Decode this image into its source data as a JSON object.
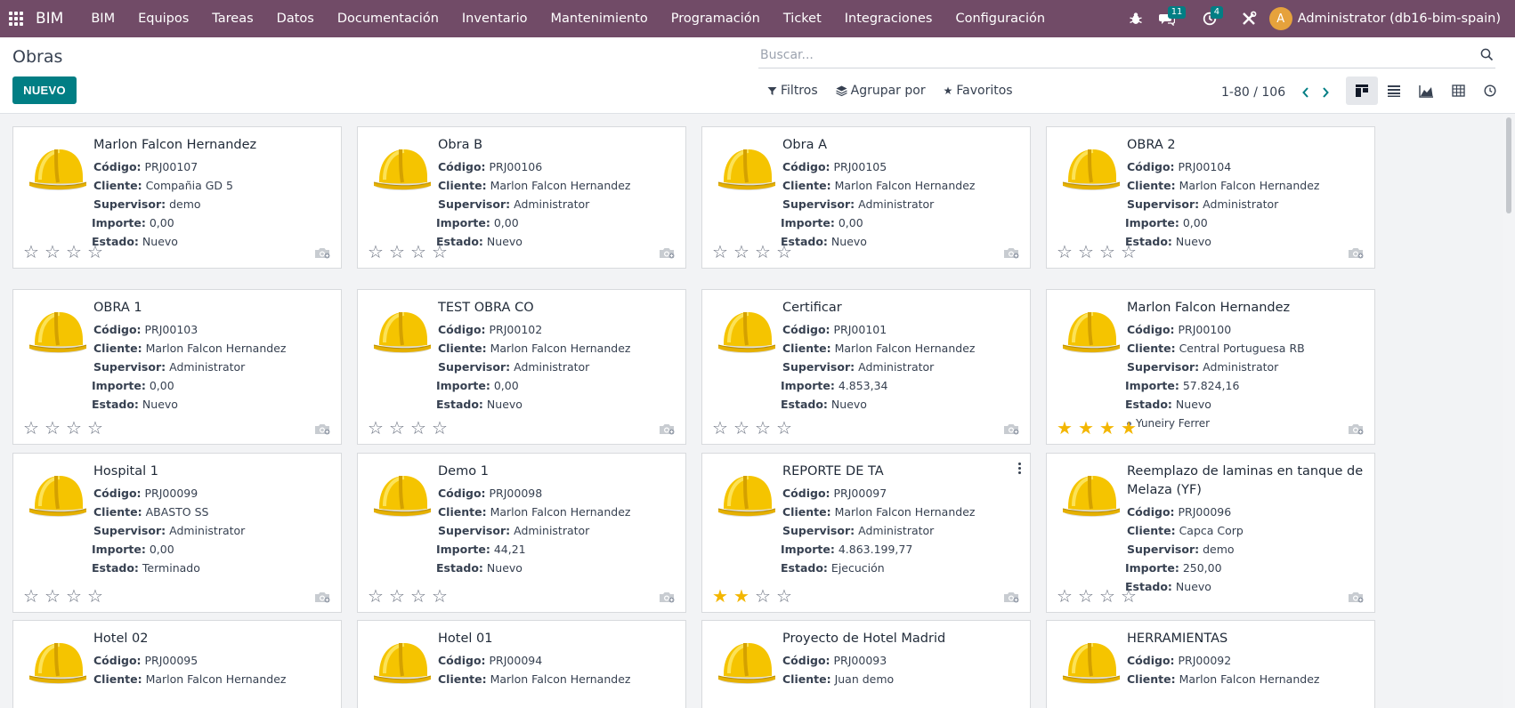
{
  "navbar": {
    "app_name": "BIM",
    "menu": [
      "BIM",
      "Equipos",
      "Tareas",
      "Datos",
      "Documentación",
      "Inventario",
      "Mantenimiento",
      "Programación",
      "Ticket",
      "Integraciones",
      "Configuración"
    ],
    "messages_count": "11",
    "activities_count": "4",
    "user_initial": "A",
    "user_name": "Administrator (db16-bim-spain)",
    "color": "#714b67"
  },
  "control_panel": {
    "title": "Obras",
    "new_button": "NUEVO",
    "search_placeholder": "Buscar...",
    "filters_label": "Filtros",
    "group_by_label": "Agrupar por",
    "favorites_label": "Favoritos",
    "pager_value": "1-80 / 106",
    "active_view": "kanban",
    "accent_color": "#017e84"
  },
  "labels": {
    "code": "Código:",
    "client": "Cliente:",
    "supervisor": "Supervisor:",
    "amount": "Importe:",
    "state": "Estado:"
  },
  "cards": [
    {
      "title": "Marlon Falcon Hernandez",
      "code": "PRJ00107",
      "client": "Compañia GD 5",
      "supervisor": "demo",
      "amount": "0,00",
      "state": "Nuevo",
      "stars": 0
    },
    {
      "title": "Obra B",
      "code": "PRJ00106",
      "client": "Marlon Falcon Hernandez",
      "supervisor": "Administrator",
      "amount": "0,00",
      "state": "Nuevo",
      "stars": 0
    },
    {
      "title": "Obra A",
      "code": "PRJ00105",
      "client": "Marlon Falcon Hernandez",
      "supervisor": "Administrator",
      "amount": "0,00",
      "state": "Nuevo",
      "stars": 0
    },
    {
      "title": "OBRA 2",
      "code": "PRJ00104",
      "client": "Marlon Falcon Hernandez",
      "supervisor": "Administrator",
      "amount": "0,00",
      "state": "Nuevo",
      "stars": 0
    },
    {
      "title": "OBRA 1",
      "code": "PRJ00103",
      "client": "Marlon Falcon Hernandez",
      "supervisor": "Administrator",
      "amount": "0,00",
      "state": "Nuevo",
      "stars": 0
    },
    {
      "title": "TEST OBRA CO",
      "code": "PRJ00102",
      "client": "Marlon Falcon Hernandez",
      "supervisor": "Administrator",
      "amount": "0,00",
      "state": "Nuevo",
      "stars": 0
    },
    {
      "title": "Certificar",
      "code": "PRJ00101",
      "client": "Marlon Falcon Hernandez",
      "supervisor": "Administrator",
      "amount": "4.853,34",
      "state": "Nuevo",
      "stars": 0
    },
    {
      "title": "Marlon Falcon Hernandez",
      "code": "PRJ00100",
      "client": "Central Portuguesa RB",
      "supervisor": "Administrator",
      "amount": "57.824,16",
      "state": "Nuevo",
      "stars": 4,
      "tag": "Yuneiry Ferrer"
    },
    {
      "title": "Hospital 1",
      "code": "PRJ00099",
      "client": "ABASTO SS",
      "supervisor": "Administrator",
      "amount": "0,00",
      "state": "Terminado",
      "stars": 0
    },
    {
      "title": "Demo 1",
      "code": "PRJ00098",
      "client": "Marlon Falcon Hernandez",
      "supervisor": "Administrator",
      "amount": "44,21",
      "state": "Nuevo",
      "stars": 0
    },
    {
      "title": "REPORTE DE TA",
      "code": "PRJ00097",
      "client": "Marlon Falcon Hernandez",
      "supervisor": "Administrator",
      "amount": "4.863.199,77",
      "state": "Ejecución",
      "stars": 2,
      "menu": true
    },
    {
      "title": "Reemplazo de laminas en tanque de Melaza (YF)",
      "code": "PRJ00096",
      "client": "Capca Corp",
      "supervisor": "demo",
      "amount": "250,00",
      "state": "Nuevo",
      "stars": 0
    },
    {
      "title": "Hotel 02",
      "code": "PRJ00095",
      "client": "Marlon Falcon Hernandez"
    },
    {
      "title": "Hotel 01",
      "code": "PRJ00094",
      "client": "Marlon Falcon Hernandez"
    },
    {
      "title": "Proyecto de Hotel Madrid",
      "code": "PRJ00093",
      "client": "Juan demo"
    },
    {
      "title": "HERRAMIENTAS",
      "code": "PRJ00092",
      "client": "Marlon Falcon Hernandez"
    }
  ],
  "icons": {
    "apps": "apps-grid-icon",
    "bug": "bug-icon",
    "chat": "chat-icon",
    "clock": "clock-icon",
    "tools": "tools-icon",
    "search": "search-icon",
    "filter": "filter-icon",
    "group": "layers-icon",
    "favorite": "star-icon",
    "camera": "camera-icon",
    "helmet": "hard-hat-icon"
  }
}
